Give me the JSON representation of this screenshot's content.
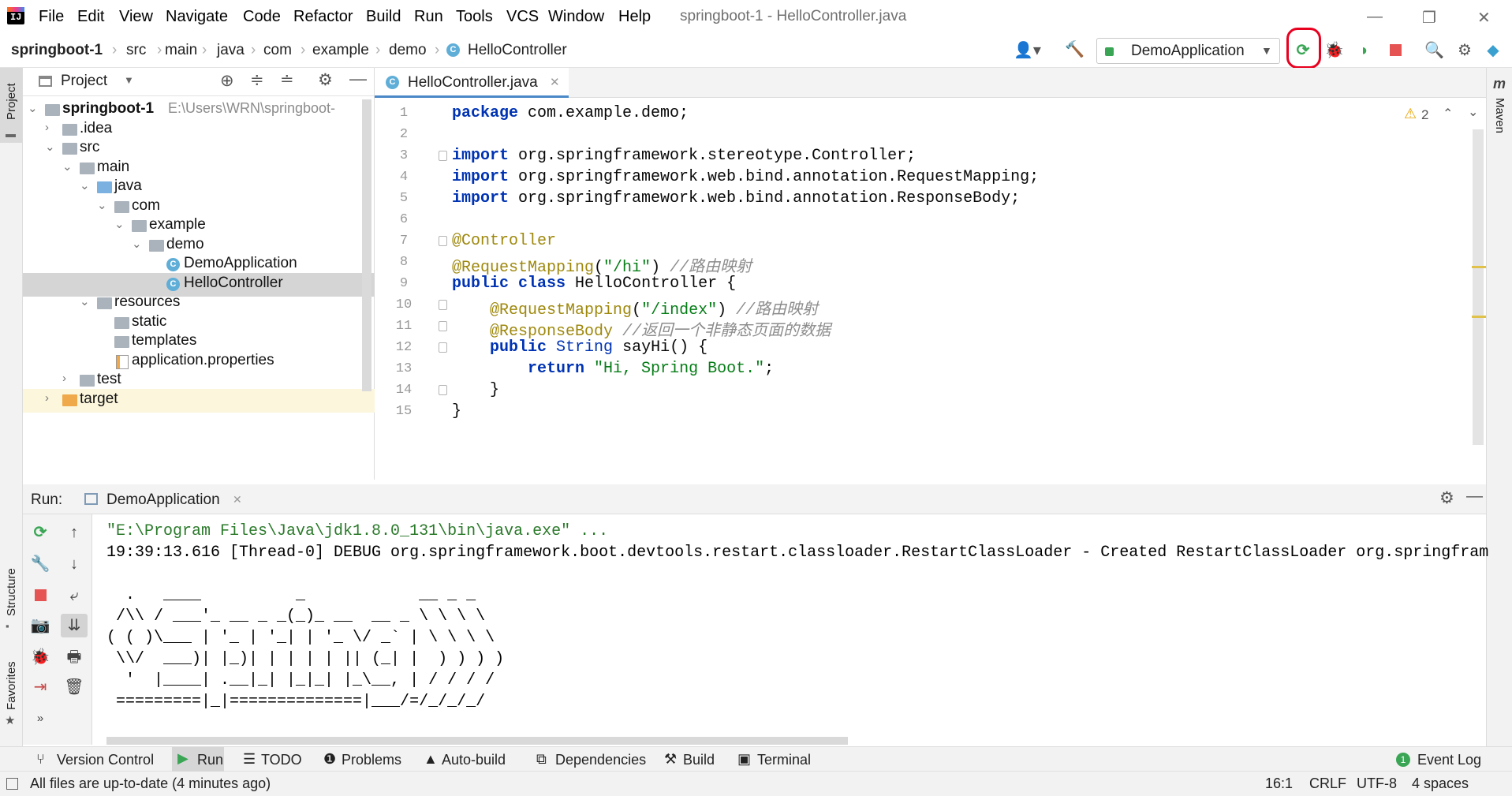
{
  "menu": [
    "File",
    "Edit",
    "View",
    "Navigate",
    "Code",
    "Refactor",
    "Build",
    "Run",
    "Tools",
    "VCS",
    "Window",
    "Help"
  ],
  "window_title": "springboot-1 - HelloController.java",
  "breadcrumb": [
    "springboot-1",
    "src",
    "main",
    "java",
    "com",
    "example",
    "demo",
    "HelloController"
  ],
  "run_config": "DemoApplication",
  "colors": {
    "accent": "#4a88c7",
    "highlight_circle": "#e8001f",
    "run_green": "#3aa655"
  },
  "project_panel": {
    "title": "Project",
    "tree": [
      {
        "label": "springboot-1",
        "extra": "E:\\Users\\WRN\\springboot-",
        "depth": 0,
        "expanded": true,
        "bold": true
      },
      {
        "label": ".idea",
        "depth": 1,
        "expanded": false
      },
      {
        "label": "src",
        "depth": 1,
        "expanded": true
      },
      {
        "label": "main",
        "depth": 2,
        "expanded": true
      },
      {
        "label": "java",
        "depth": 3,
        "expanded": true
      },
      {
        "label": "com",
        "depth": 4,
        "expanded": true
      },
      {
        "label": "example",
        "depth": 5,
        "expanded": true
      },
      {
        "label": "demo",
        "depth": 6,
        "expanded": true
      },
      {
        "label": "DemoApplication",
        "depth": 7
      },
      {
        "label": "HelloController",
        "depth": 7,
        "selected": true
      },
      {
        "label": "resources",
        "depth": 3,
        "expanded": true
      },
      {
        "label": "static",
        "depth": 4
      },
      {
        "label": "templates",
        "depth": 4
      },
      {
        "label": "application.properties",
        "depth": 4
      },
      {
        "label": "test",
        "depth": 2,
        "expanded": false
      },
      {
        "label": "target",
        "depth": 1,
        "expanded": false
      }
    ]
  },
  "editor": {
    "tab": "HelloController.java",
    "warnings": "2",
    "lines": [
      {
        "n": "1",
        "code": "package com.example.demo;"
      },
      {
        "n": "2",
        "code": ""
      },
      {
        "n": "3",
        "code": "import org.springframework.stereotype.Controller;"
      },
      {
        "n": "4",
        "code": "import org.springframework.web.bind.annotation.RequestMapping;"
      },
      {
        "n": "5",
        "code": "import org.springframework.web.bind.annotation.ResponseBody;"
      },
      {
        "n": "6",
        "code": ""
      },
      {
        "n": "7",
        "code": "@Controller"
      },
      {
        "n": "8",
        "code": "@RequestMapping(\"/hi\") //路由映射"
      },
      {
        "n": "9",
        "code": "public class HelloController {"
      },
      {
        "n": "10",
        "code": "    @RequestMapping(\"/index\") //路由映射"
      },
      {
        "n": "11",
        "code": "    @ResponseBody //返回一个非静态页面的数据"
      },
      {
        "n": "12",
        "code": "    public String sayHi() {"
      },
      {
        "n": "13",
        "code": "        return \"Hi, Spring Boot.\";"
      },
      {
        "n": "14",
        "code": "    }"
      },
      {
        "n": "15",
        "code": "}"
      }
    ]
  },
  "run_panel": {
    "label": "Run:",
    "tab": "DemoApplication",
    "console": [
      "\"E:\\Program Files\\Java\\jdk1.8.0_131\\bin\\java.exe\" ...",
      "19:39:13.616 [Thread-0] DEBUG org.springframework.boot.devtools.restart.classloader.RestartClassLoader - Created RestartClassLoader org.springfram",
      "",
      "  .   ____          _            __ _ _",
      " /\\\\ / ___'_ __ _ _(_)_ __  __ _ \\ \\ \\ \\",
      "( ( )\\___ | '_ | '_| | '_ \\/ _` | \\ \\ \\ \\",
      " \\\\/  ___)| |_)| | | | | || (_| |  ) ) ) )",
      "  '  |____| .__|_| |_|_| |_\\__, | / / / /",
      " =========|_|==============|___/=/_/_/_/"
    ]
  },
  "side_labels": {
    "project": "Project",
    "structure": "Structure",
    "favorites": "Favorites",
    "maven": "Maven"
  },
  "bottom_tabs": [
    "Version Control",
    "Run",
    "TODO",
    "Problems",
    "Auto-build",
    "Dependencies",
    "Build",
    "Terminal"
  ],
  "event_log": "Event Log",
  "status": {
    "message": "All files are up-to-date (4 minutes ago)",
    "position": "16:1",
    "line_sep": "CRLF",
    "encoding": "UTF-8",
    "indent": "4 spaces"
  }
}
